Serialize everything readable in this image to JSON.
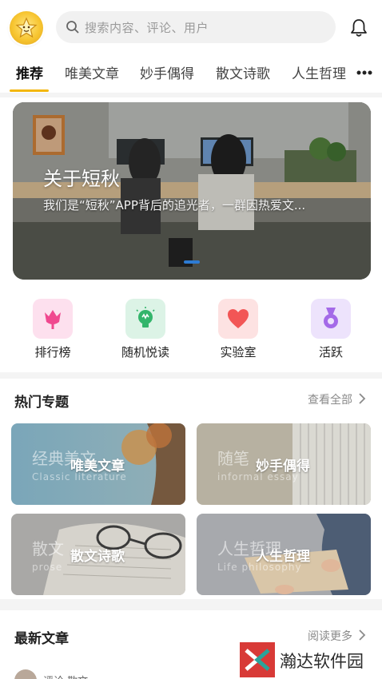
{
  "header": {
    "search_placeholder": "搜索内容、评论、用户"
  },
  "tabs": [
    {
      "label": "推荐",
      "active": true
    },
    {
      "label": "唯美文章"
    },
    {
      "label": "妙手偶得"
    },
    {
      "label": "散文诗歌"
    },
    {
      "label": "人生哲理"
    }
  ],
  "banner": {
    "title": "关于短秋",
    "subtitle": "我们是“短秋”APP背后的追光者，一群因热爱文..."
  },
  "quick_links": [
    {
      "label": "排行榜",
      "icon": "tulip-icon",
      "bg": "#fde0ee",
      "color": "#f0488f"
    },
    {
      "label": "随机悦读",
      "icon": "lightbulb-icon",
      "bg": "#dcf3e6",
      "color": "#33b56b"
    },
    {
      "label": "实验室",
      "icon": "heart-icon",
      "bg": "#fde2e2",
      "color": "#f25656"
    },
    {
      "label": "活跃",
      "icon": "medal-icon",
      "bg": "#ede3fc",
      "color": "#a46ae8"
    }
  ],
  "hot_topics": {
    "title": "热门专题",
    "link": "查看全部",
    "cards": [
      {
        "title": "唯美文章",
        "bg_text": "经典美文",
        "bg_sub": "Classic literature"
      },
      {
        "title": "妙手偶得",
        "bg_text": "随笔",
        "bg_sub": "informal essay"
      },
      {
        "title": "散文诗歌",
        "bg_text": "散文",
        "bg_sub": "prose"
      },
      {
        "title": "人生哲理",
        "bg_text": "人生哲理",
        "bg_sub": "Life philosophy"
      }
    ]
  },
  "latest": {
    "title": "最新文章",
    "link": "阅读更多",
    "author_partial": "评论·散文"
  },
  "watermark": "瀚达软件园",
  "colors": {
    "accent": "#f3b70e",
    "banner_dot": "#2d7bd3"
  }
}
